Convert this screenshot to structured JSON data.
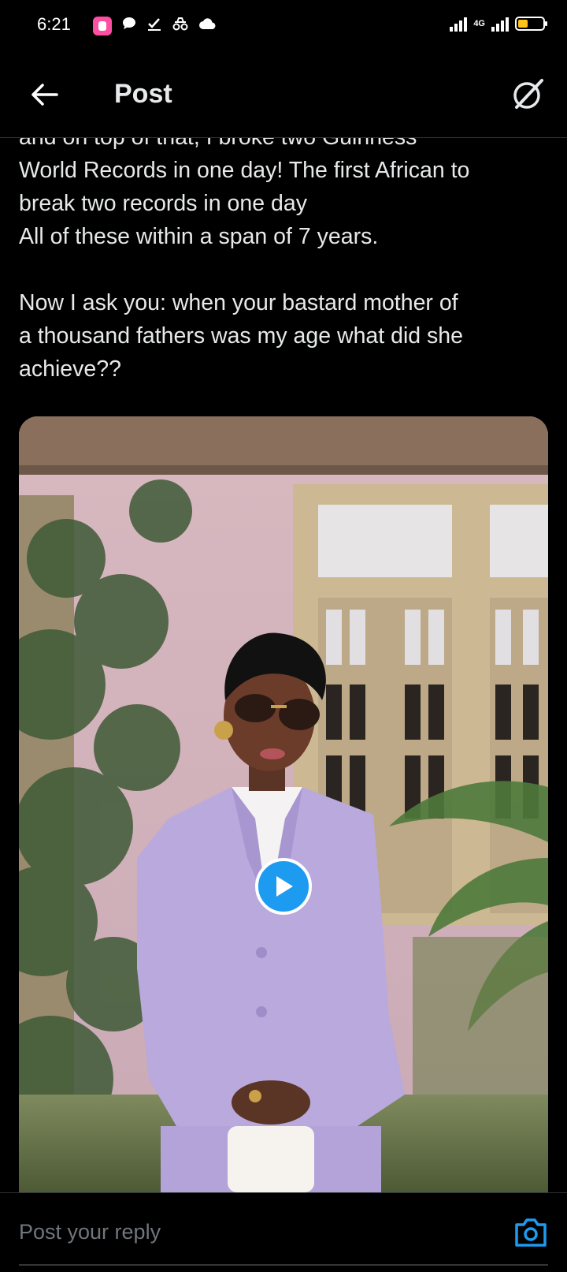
{
  "status_bar": {
    "time": "6:21",
    "network": "4G",
    "icons": [
      "app-badge-icon",
      "chat-bubble-icon",
      "check-icon",
      "vpn-icon",
      "cloud-icon"
    ],
    "battery_level": 0.4,
    "battery_color": "#ffc21a"
  },
  "header": {
    "title": "Post",
    "back_icon": "arrow-left-icon",
    "grok_icon": "grok-icon"
  },
  "post": {
    "text_partial_line": "and on top of that, I broke two Guinness",
    "text": "World Records in one day! The first African to\nbreak two records in one day\nAll of these within a span of 7 years.\n\nNow I ask you: when your bastard mother of\na thousand fathers was my age what did she\nachieve??"
  },
  "media": {
    "type": "video",
    "play_icon": "play-icon",
    "accent": "#1d9bf0"
  },
  "reply": {
    "placeholder": "Post your reply",
    "camera_icon": "camera-icon"
  }
}
